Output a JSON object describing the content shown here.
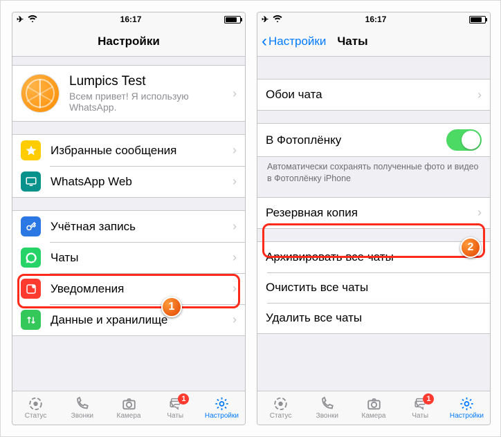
{
  "status": {
    "time": "16:17"
  },
  "screen1": {
    "nav_title": "Настройки",
    "profile": {
      "name": "Lumpics Test",
      "status": "Всем привет! Я использую WhatsApp."
    },
    "starred": "Избранные сообщения",
    "web": "WhatsApp Web",
    "account": "Учётная запись",
    "chats": "Чаты",
    "notifications": "Уведомления",
    "data": "Данные и хранилище"
  },
  "screen2": {
    "back": "Настройки",
    "title": "Чаты",
    "wallpaper": "Обои чата",
    "camera_roll": "В Фотоплёнку",
    "camera_roll_footer": "Автоматически сохранять полученные фото и видео в Фотоплёнку iPhone",
    "backup": "Резервная копия",
    "archive_all": "Архивировать все чаты",
    "clear_all": "Очистить все чаты",
    "delete_all": "Удалить все чаты"
  },
  "tabs": {
    "status": "Статус",
    "calls": "Звонки",
    "camera": "Камера",
    "chats": "Чаты",
    "settings": "Настройки",
    "chats_badge": "1"
  },
  "callouts": {
    "n1": "1",
    "n2": "2"
  }
}
